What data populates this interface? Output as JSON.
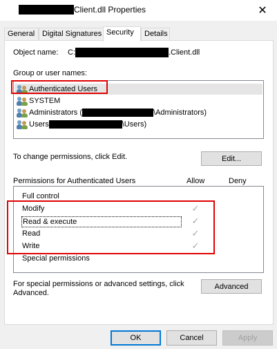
{
  "window": {
    "title": "Client.dll Properties",
    "close_glyph": "✕"
  },
  "tabs": [
    {
      "label": "General"
    },
    {
      "label": "Digital Signatures"
    },
    {
      "label": "Security"
    },
    {
      "label": "Details"
    }
  ],
  "object": {
    "label": "Object name:",
    "prefix": "C:",
    "suffix": ".Client.dll"
  },
  "groups": {
    "label": "Group or user names:",
    "items": [
      {
        "name": "Authenticated Users",
        "icon": "users-icon",
        "selected": true
      },
      {
        "name": "SYSTEM",
        "icon": "users-icon"
      },
      {
        "name_prefix": "Administrators (",
        "name_suffix": "\\Administrators)",
        "icon": "users-icon"
      },
      {
        "name_prefix": "Users ",
        "name_suffix": "\\Users)",
        "icon": "users-icon"
      }
    ]
  },
  "change_permissions": {
    "text": "To change permissions, click Edit.",
    "edit_label": "Edit..."
  },
  "permissions": {
    "header": "Permissions for Authenticated Users",
    "allow_label": "Allow",
    "deny_label": "Deny",
    "check_glyph": "✓",
    "rows": [
      {
        "name": "Full control",
        "allow": false,
        "deny": false
      },
      {
        "name": "Modify",
        "allow": true,
        "deny": false
      },
      {
        "name": "Read & execute",
        "allow": true,
        "deny": false
      },
      {
        "name": "Read",
        "allow": true,
        "deny": false
      },
      {
        "name": "Write",
        "allow": true,
        "deny": false
      },
      {
        "name": "Special permissions",
        "allow": false,
        "deny": false
      }
    ]
  },
  "advanced": {
    "text_line1": "For special permissions or advanced settings, click",
    "text_line2": "Advanced.",
    "button_label": "Advanced"
  },
  "footer": {
    "ok_label": "OK",
    "cancel_label": "Cancel",
    "apply_label": "Apply"
  },
  "colors": {
    "highlight": "#e00000",
    "selected_bg": "#e5e5e5",
    "check": "#a8a8a8"
  }
}
